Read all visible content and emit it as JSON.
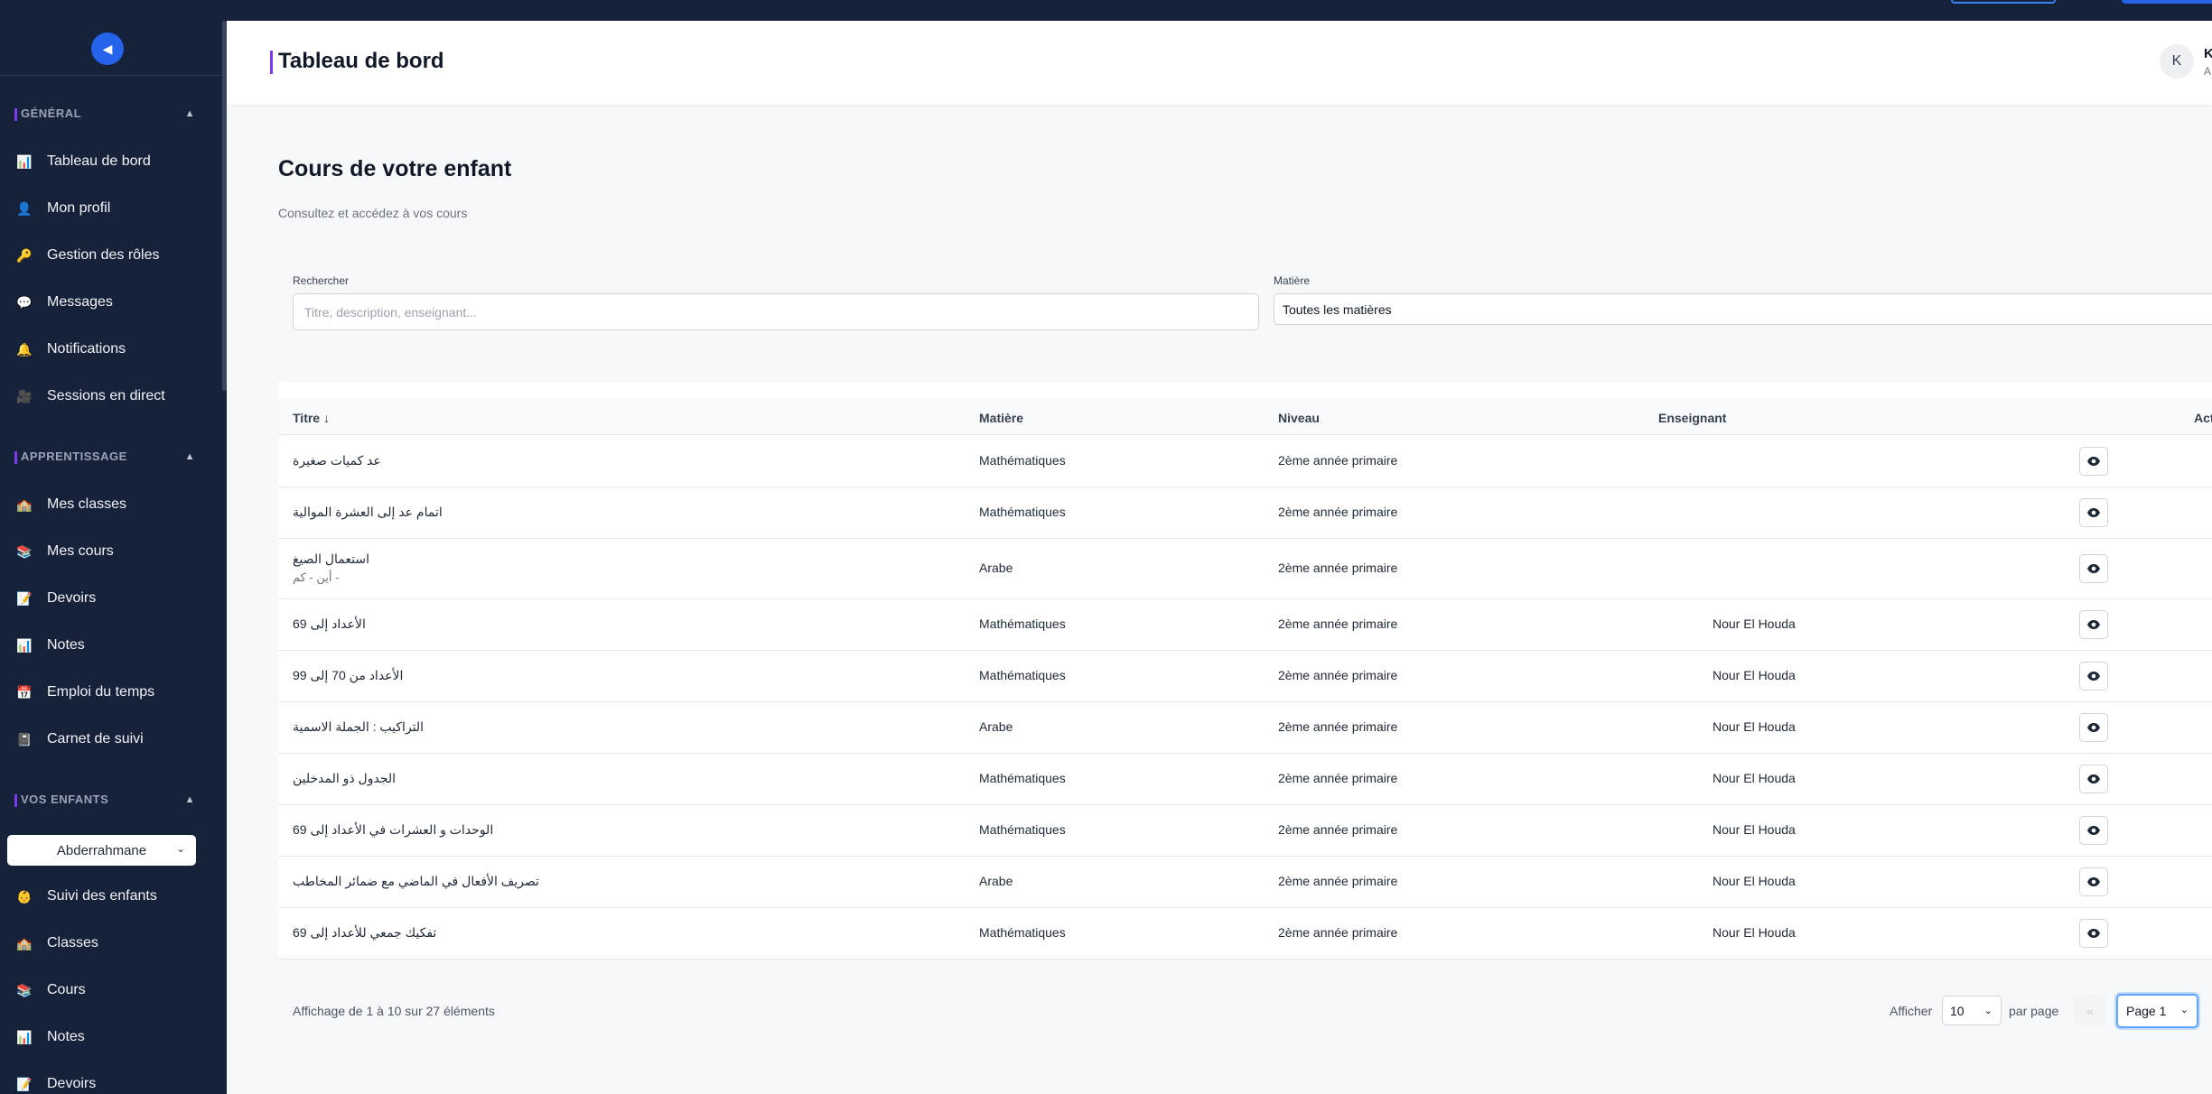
{
  "header": {
    "title": "Tableau de bord",
    "user_initial": "K",
    "user_name": "K",
    "user_role": "A"
  },
  "sidebar": {
    "collapse_glyph": "◀",
    "sections": [
      {
        "label": "GÉNÉRAL",
        "caret": "▲"
      },
      {
        "label": "APPRENTISSAGE",
        "caret": "▲"
      },
      {
        "label": "VOS ENFANTS",
        "caret": "▲"
      }
    ],
    "general_items": [
      {
        "label": "Tableau de bord",
        "icon": "chart-icon",
        "glyph": "📊"
      },
      {
        "label": "Mon profil",
        "icon": "user-icon",
        "glyph": "👤"
      },
      {
        "label": "Gestion des rôles",
        "icon": "key-icon",
        "glyph": "🔑"
      },
      {
        "label": "Messages",
        "icon": "chat-icon",
        "glyph": "💬"
      },
      {
        "label": "Notifications",
        "icon": "bell-icon",
        "glyph": "🔔"
      },
      {
        "label": "Sessions en direct",
        "icon": "video-icon",
        "glyph": "🎥"
      }
    ],
    "learning_items": [
      {
        "label": "Mes classes",
        "icon": "school-icon",
        "glyph": "🏫"
      },
      {
        "label": "Mes cours",
        "icon": "books-icon",
        "glyph": "📚"
      },
      {
        "label": "Devoirs",
        "icon": "memo-icon",
        "glyph": "📝"
      },
      {
        "label": "Notes",
        "icon": "chart-icon",
        "glyph": "📊"
      },
      {
        "label": "Emploi du temps",
        "icon": "calendar-icon",
        "glyph": "📅"
      },
      {
        "label": "Carnet de suivi",
        "icon": "notebook-icon",
        "glyph": "📓"
      }
    ],
    "child_select": "Abderrahmane",
    "children_items": [
      {
        "label": "Suivi des enfants",
        "icon": "child-icon",
        "glyph": "👶"
      },
      {
        "label": "Classes",
        "icon": "school-icon",
        "glyph": "🏫"
      },
      {
        "label": "Cours",
        "icon": "books-icon",
        "glyph": "📚"
      },
      {
        "label": "Notes",
        "icon": "chart-icon",
        "glyph": "📊"
      },
      {
        "label": "Devoirs",
        "icon": "memo-icon",
        "glyph": "📝"
      }
    ]
  },
  "main": {
    "title": "Cours de votre enfant",
    "subtitle": "Consultez et accédez à vos cours",
    "search_label": "Rechercher",
    "search_placeholder": "Titre, description, enseignant...",
    "subject_label": "Matière",
    "subject_value": "Toutes les matières"
  },
  "table": {
    "columns": [
      "Titre ↓",
      "Matière",
      "Niveau",
      "Enseignant",
      "Actions"
    ],
    "rows": [
      {
        "title": "عد كميات صغيرة",
        "subtitle": "",
        "subject": "Mathématiques",
        "level": "2ème année primaire",
        "teacher": ""
      },
      {
        "title": "اتمام عد إلى العشرة الموالية",
        "subtitle": "",
        "subject": "Mathématiques",
        "level": "2ème année primaire",
        "teacher": ""
      },
      {
        "title": "استعمال الصيغ",
        "subtitle": "- أين - كم",
        "subject": "Arabe",
        "level": "2ème année primaire",
        "teacher": ""
      },
      {
        "title": "الأعداد إلى 69",
        "subtitle": "",
        "subject": "Mathématiques",
        "level": "2ème année primaire",
        "teacher": "Nour El Houda"
      },
      {
        "title": "الأعداد من 70 إلى 99",
        "subtitle": "",
        "subject": "Mathématiques",
        "level": "2ème année primaire",
        "teacher": "Nour El Houda"
      },
      {
        "title": "التراكيب : الجملة الاسمية",
        "subtitle": "",
        "subject": "Arabe",
        "level": "2ème année primaire",
        "teacher": "Nour El Houda"
      },
      {
        "title": "الجدول ذو المدخلين",
        "subtitle": "",
        "subject": "Mathématiques",
        "level": "2ème année primaire",
        "teacher": "Nour El Houda"
      },
      {
        "title": "الوحدات و العشرات في الأعداد إلى 69",
        "subtitle": "",
        "subject": "Mathématiques",
        "level": "2ème année primaire",
        "teacher": "Nour El Houda"
      },
      {
        "title": "تصريف الأفعال في الماضي مع ضمائر المخاطب",
        "subtitle": "",
        "subject": "Arabe",
        "level": "2ème année primaire",
        "teacher": "Nour El Houda"
      },
      {
        "title": "تفكيك جمعي للأعداد إلى 69",
        "subtitle": "",
        "subject": "Mathématiques",
        "level": "2ème année primaire",
        "teacher": "Nour El Houda"
      }
    ]
  },
  "footer": {
    "info": "Affichage de 1 à 10 sur 27 éléments",
    "show_label": "Afficher",
    "per_page_value": "10",
    "per_page_label": "par page",
    "prev_glyph": "«",
    "page_value": "Page 1"
  }
}
